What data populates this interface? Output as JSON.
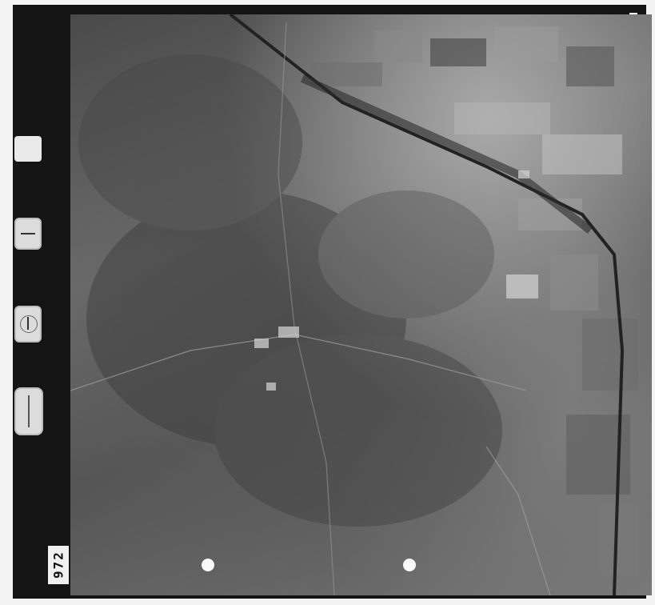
{
  "image": {
    "type": "aerial-photograph",
    "tone": "grayscale"
  },
  "frame_label": {
    "number": "972"
  },
  "colors": {
    "film_border": "#141414",
    "background": "#f4f4f4"
  }
}
